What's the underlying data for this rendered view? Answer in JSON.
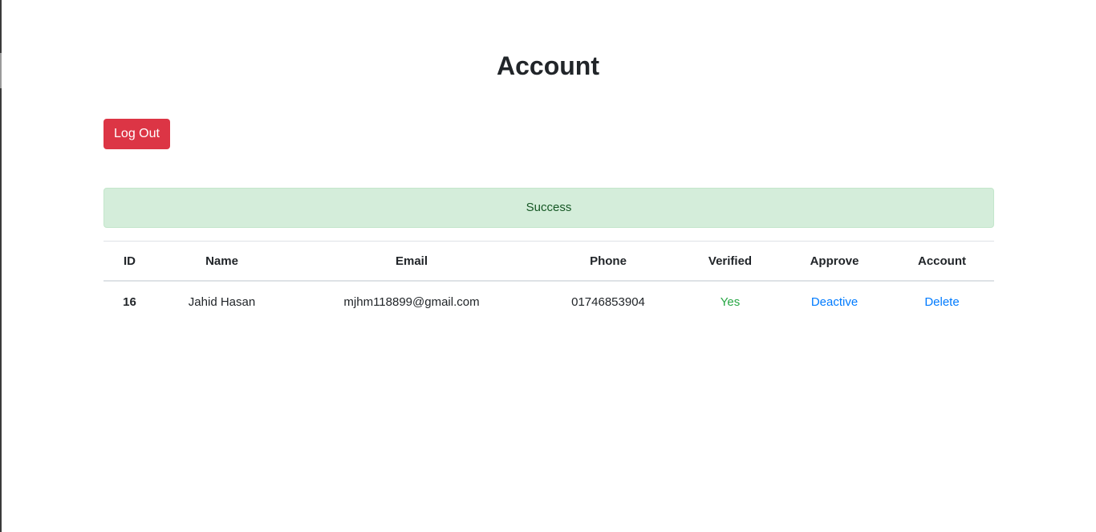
{
  "page": {
    "title": "Account"
  },
  "toolbar": {
    "logout_label": "Log Out"
  },
  "alert": {
    "message": "Success"
  },
  "table": {
    "headers": [
      "ID",
      "Name",
      "Email",
      "Phone",
      "Verified",
      "Approve",
      "Account"
    ],
    "rows": [
      {
        "id": "16",
        "name": "Jahid Hasan",
        "email": "mjhm118899@gmail.com",
        "phone": "01746853904",
        "verified": "Yes",
        "approve_action": "Deactive",
        "account_action": "Delete"
      }
    ]
  },
  "colors": {
    "danger": "#dc3545",
    "success_bg": "#d4edda",
    "success_text": "#155724",
    "verified_text": "#28a745",
    "link": "#007bff"
  }
}
